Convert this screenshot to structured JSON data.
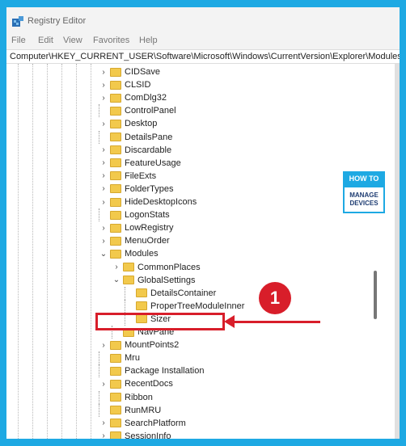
{
  "window": {
    "title": "Registry Editor"
  },
  "menu": [
    {
      "label": "File"
    },
    {
      "label": "Edit"
    },
    {
      "label": "View"
    },
    {
      "label": "Favorites"
    },
    {
      "label": "Help"
    }
  ],
  "address": "Computer\\HKEY_CURRENT_USER\\Software\\Microsoft\\Windows\\CurrentVersion\\Explorer\\Modules",
  "tree": [
    {
      "label": "CIDSave",
      "expander": "collapsed"
    },
    {
      "label": "CLSID",
      "expander": "collapsed"
    },
    {
      "label": "ComDlg32",
      "expander": "collapsed"
    },
    {
      "label": "ControlPanel",
      "expander": "none"
    },
    {
      "label": "Desktop",
      "expander": "collapsed"
    },
    {
      "label": "DetailsPane",
      "expander": "none"
    },
    {
      "label": "Discardable",
      "expander": "collapsed"
    },
    {
      "label": "FeatureUsage",
      "expander": "collapsed"
    },
    {
      "label": "FileExts",
      "expander": "collapsed"
    },
    {
      "label": "FolderTypes",
      "expander": "collapsed"
    },
    {
      "label": "HideDesktopIcons",
      "expander": "collapsed"
    },
    {
      "label": "LogonStats",
      "expander": "none"
    },
    {
      "label": "LowRegistry",
      "expander": "collapsed"
    },
    {
      "label": "MenuOrder",
      "expander": "collapsed"
    },
    {
      "label": "Modules",
      "expander": "expanded"
    },
    {
      "label": "CommonPlaces",
      "expander": "collapsed"
    },
    {
      "label": "GlobalSettings",
      "expander": "expanded"
    },
    {
      "label": "DetailsContainer",
      "expander": "none"
    },
    {
      "label": "ProperTreeModuleInner",
      "expander": "none"
    },
    {
      "label": "Sizer",
      "expander": "none"
    },
    {
      "label": "NavPane",
      "expander": "none"
    },
    {
      "label": "MountPoints2",
      "expander": "collapsed"
    },
    {
      "label": "Mru",
      "expander": "none"
    },
    {
      "label": "Package Installation",
      "expander": "none"
    },
    {
      "label": "RecentDocs",
      "expander": "collapsed"
    },
    {
      "label": "Ribbon",
      "expander": "none"
    },
    {
      "label": "RunMRU",
      "expander": "none"
    },
    {
      "label": "SearchPlatform",
      "expander": "collapsed"
    },
    {
      "label": "SessionInfo",
      "expander": "collapsed"
    }
  ],
  "watermark": {
    "top": "HOW TO",
    "line1": "MANAGE",
    "line2": "DEVICES"
  },
  "annotation": {
    "number": "1"
  },
  "colors": {
    "background": "#1ea9e3",
    "highlight": "#d81e2a",
    "folder": "#f2c94c"
  }
}
